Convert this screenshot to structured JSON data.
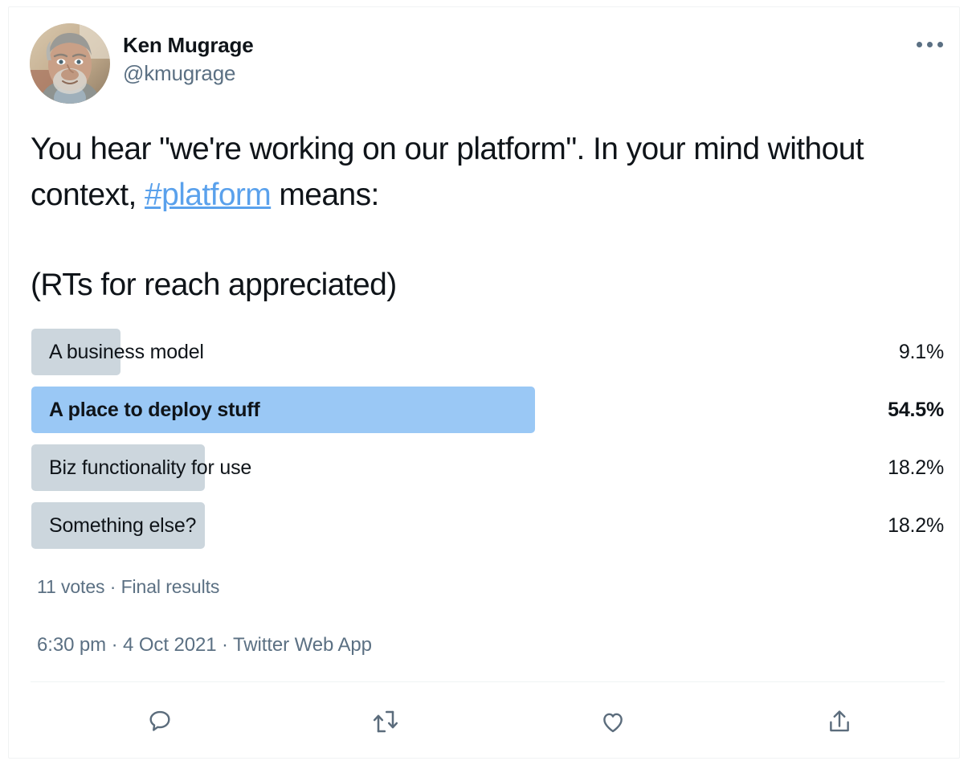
{
  "author": {
    "display_name": "Ken Mugrage",
    "handle": "@kmugrage",
    "avatar_icon": "profile-photo"
  },
  "more_menu": {
    "icon": "more-horizontal-icon",
    "label": "More"
  },
  "tweet": {
    "line1_before_hashtag": "You hear \"we're working on our platform\". In your mind without context, ",
    "hashtag": "#platform",
    "line1_after_hashtag": " means:",
    "line2": "(RTs for reach appreciated)"
  },
  "poll": {
    "options": [
      {
        "label": "A business model",
        "percent": "9.1%",
        "value": 9.1,
        "winner": false,
        "bar_color": "#ccd6dd"
      },
      {
        "label": "A place to deploy stuff",
        "percent": "54.5%",
        "value": 54.5,
        "winner": true,
        "bar_color": "#9ac8f5"
      },
      {
        "label": "Biz functionality for use",
        "percent": "18.2%",
        "value": 18.2,
        "winner": false,
        "bar_color": "#ccd6dd"
      },
      {
        "label": "Something else?",
        "percent": "18.2%",
        "value": 18.2,
        "winner": false,
        "bar_color": "#ccd6dd"
      }
    ],
    "meta": "11 votes · Final results",
    "votes": "11 votes",
    "status": "Final results"
  },
  "timestamp": {
    "full": "6:30 pm · 4 Oct 2021 · Twitter Web App",
    "time": "6:30 pm",
    "date": "4 Oct 2021",
    "source": "Twitter Web App"
  },
  "actions": [
    {
      "name": "reply",
      "icon": "reply-icon",
      "count": ""
    },
    {
      "name": "retweet",
      "icon": "retweet-icon",
      "count": ""
    },
    {
      "name": "like",
      "icon": "heart-icon",
      "count": ""
    },
    {
      "name": "share",
      "icon": "share-icon",
      "count": ""
    }
  ],
  "colors": {
    "text": "#0f1419",
    "muted": "#5b7083",
    "link": "#5aa1ec",
    "winner_bar": "#9ac8f5",
    "bar": "#ccd6dd",
    "divider": "#eff3f4"
  }
}
